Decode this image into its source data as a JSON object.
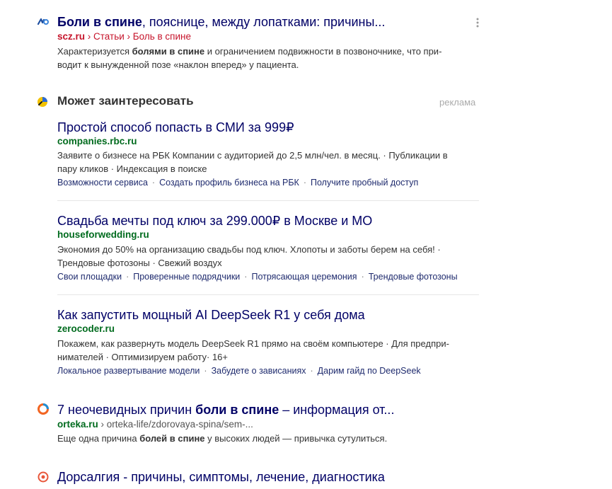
{
  "result1": {
    "title_bold": "Боли в спине",
    "title_rest": ", пояснице, между лопатками: причины...",
    "host": "scz.ru",
    "crumb1": "Статьи",
    "crumb2": "Боль в спине",
    "desc_a": "Характеризуется ",
    "desc_bold": "болями в спине",
    "desc_b": " и ограничением подвижности в позвоночнике, что при-",
    "desc_line2": "водит к вынужденной позе «наклон вперед» у пациента."
  },
  "ads": {
    "heading": "Может заинтересовать",
    "ad_label": "реклама",
    "items": [
      {
        "title": "Простой способ попасть в СМИ за 999₽",
        "host": "companies.rbc.ru",
        "line1": "Заявите о бизнесе на РБК Компании с аудиторией до 2,5 млн/чел. в месяц. · Публикации в",
        "line2": "пару кликов · Индексация в поиске",
        "links": [
          "Возможности сервиса",
          "Создать профиль бизнеса на РБК",
          "Получите пробный доступ"
        ]
      },
      {
        "title": "Свадьба мечты под ключ за 299.000₽ в Москве и МО",
        "host": "houseforwedding.ru",
        "line1": "Экономия до 50% на организацию свадьбы под ключ. Хлопоты и заботы берем на себя! ·",
        "line2": "Трендовые фотозоны · Свежий воздух",
        "links": [
          "Свои площадки",
          "Проверенные подрядчики",
          "Потрясающая церемония",
          "Трендовые фотозоны"
        ]
      },
      {
        "title": "Как запустить мощный AI DeepSeek R1 у себя дома",
        "host": "zerocoder.ru",
        "line1": "Покажем, как развернуть модель DeepSeek R1 прямо на своём компьютере · Для предпри-",
        "line2": "нимателей · Оптимизируем работу· 16+",
        "links": [
          "Локальное развертывание модели",
          "Забудете о зависаниях",
          "Дарим гайд по DeepSeek"
        ]
      }
    ]
  },
  "result2": {
    "title_a": "7 неочевидных причин ",
    "title_bold": "боли в спине",
    "title_b": " – информация от...",
    "host": "orteka.ru",
    "path": " › orteka-life/zdorovaya-spina/sem-...",
    "desc_a": "Еще одна причина ",
    "desc_bold": "болей в спине",
    "desc_b": " у высоких людей — привычка сутулиться."
  },
  "result3": {
    "title": "Дорсалгия - причины, симптомы, лечение, диагностика"
  },
  "colors": {
    "title_blue": "#1a0dab",
    "title_dark": "#000066",
    "url_green": "#006b1e",
    "url_red": "#c6142b"
  },
  "icons": [
    "scz-favicon",
    "ads-icon",
    "kebab-menu-icon",
    "orteka-favicon",
    "medical-favicon"
  ]
}
